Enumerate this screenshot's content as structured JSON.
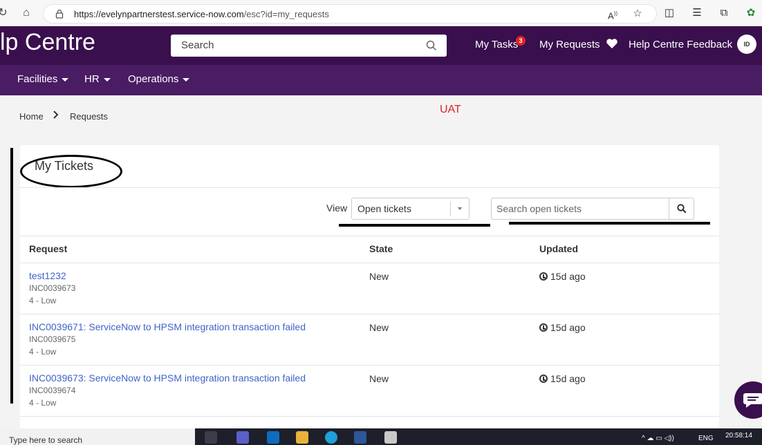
{
  "browser": {
    "url_host": "https://evelynpartnerstest.service-now.com",
    "url_path": "/esc?id=my_requests"
  },
  "header": {
    "brand": "lp Centre",
    "search_placeholder": "Search",
    "nav": {
      "my_tasks": "My Tasks",
      "my_tasks_badge": "3",
      "my_requests": "My Requests",
      "feedback": "Help Centre Feedback"
    },
    "avatar_initials": "ID"
  },
  "subnav": [
    {
      "label": "Facilities"
    },
    {
      "label": "HR"
    },
    {
      "label": "Operations"
    }
  ],
  "breadcrumb": {
    "home": "Home",
    "current": "Requests"
  },
  "env_label": "UAT",
  "card": {
    "title": "My Tickets",
    "view_label": "View",
    "view_selected": "Open tickets",
    "search_placeholder": "Search open tickets",
    "columns": {
      "request": "Request",
      "state": "State",
      "updated": "Updated"
    },
    "rows": [
      {
        "title": "test1232",
        "number": "INC0039673",
        "priority": "4 - Low",
        "state": "New",
        "updated": "15d ago"
      },
      {
        "title": "INC0039671: ServiceNow to HPSM integration transaction failed",
        "number": "INC0039675",
        "priority": "4 - Low",
        "state": "New",
        "updated": "15d ago"
      },
      {
        "title": "INC0039673: ServiceNow to HPSM integration transaction failed",
        "number": "INC0039674",
        "priority": "4 - Low",
        "state": "New",
        "updated": "15d ago"
      }
    ]
  },
  "taskbar": {
    "search_placeholder": "Type here to search",
    "lang": "ENG",
    "time": "20:58:14"
  },
  "colors": {
    "header_bg": "#3a0f4e",
    "subnav_bg": "#4a1c63",
    "link": "#3e64c8",
    "badge": "#e02424",
    "env_label": "#dd2222"
  }
}
